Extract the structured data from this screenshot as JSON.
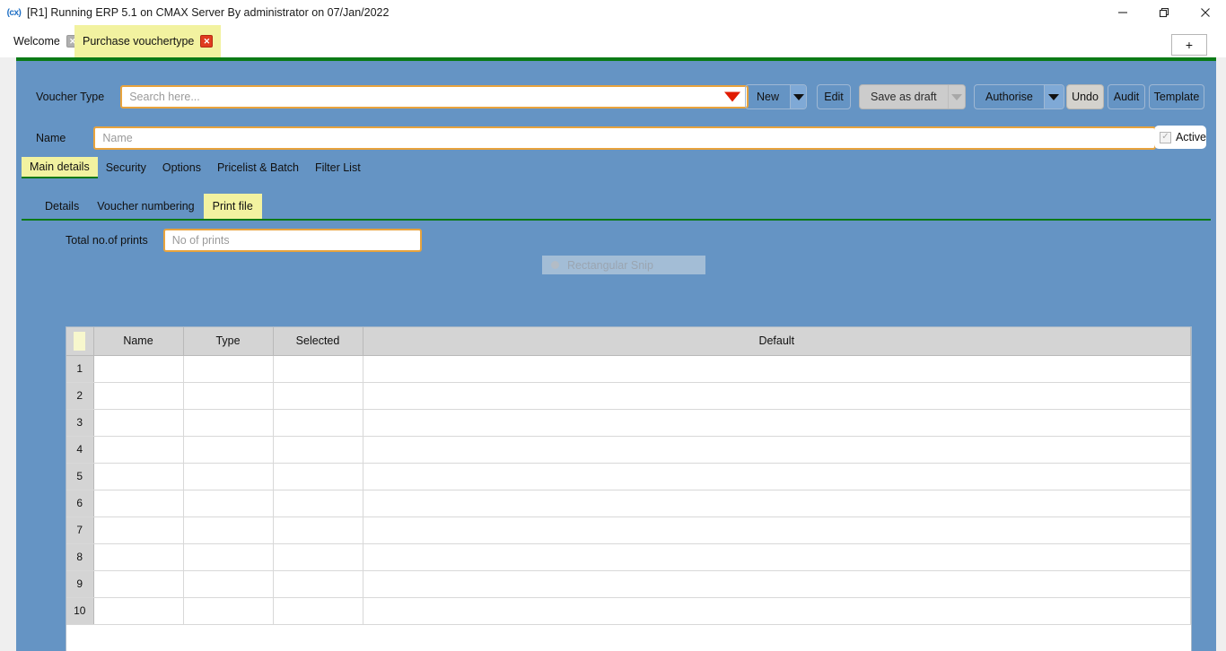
{
  "window": {
    "app_icon": "cmax-icon",
    "title": "[R1] Running ERP 5.1 on CMAX Server By administrator on 07/Jan/2022",
    "controls": {
      "minimize": "minimize-icon",
      "restore": "restore-icon",
      "close": "close-icon"
    }
  },
  "tabbar": {
    "tabs": [
      {
        "label": "Welcome",
        "active": false,
        "close_icon": "close-icon"
      },
      {
        "label": "Purchase vouchertype",
        "active": true,
        "close_icon": "close-icon"
      }
    ],
    "new_tab_label": "+"
  },
  "toolbar": {
    "voucher_type_label": "Voucher Type",
    "search_placeholder": "Search here...",
    "search_value": "",
    "dropdown_icon": "caret-down-icon",
    "buttons": [
      {
        "label": "New",
        "type": "split",
        "enabled": true
      },
      {
        "label": "Edit",
        "type": "plain",
        "enabled": true
      },
      {
        "label": "Save as draft",
        "type": "split",
        "enabled": false
      },
      {
        "label": "Authorise",
        "type": "split",
        "enabled": true
      },
      {
        "label": "Undo",
        "type": "plain",
        "enabled": false
      },
      {
        "label": "Audit",
        "type": "plain",
        "enabled": true
      },
      {
        "label": "Template",
        "type": "plain",
        "enabled": true
      }
    ]
  },
  "name_row": {
    "label": "Name",
    "placeholder": "Name",
    "value": "",
    "active_checkbox": {
      "label": "Active",
      "checked": true,
      "enabled": false,
      "check_icon": "check-icon"
    }
  },
  "main_tabs": [
    {
      "label": "Main details",
      "active": true
    },
    {
      "label": "Security",
      "active": false
    },
    {
      "label": "Options",
      "active": false
    },
    {
      "label": "Pricelist & Batch",
      "active": false
    },
    {
      "label": "Filter List",
      "active": false
    }
  ],
  "sub_tabs": [
    {
      "label": "Details",
      "active": false
    },
    {
      "label": "Voucher numbering",
      "active": false
    },
    {
      "label": "Print file",
      "active": true
    }
  ],
  "print_file": {
    "total_prints_label": "Total no.of prints",
    "total_prints_placeholder": "No of prints",
    "total_prints_value": "",
    "grid": {
      "columns": [
        "",
        "Name",
        "Type",
        "Selected",
        "Default"
      ],
      "rows": [
        {
          "no": "1",
          "name": "",
          "type": "",
          "selected": "",
          "default": ""
        },
        {
          "no": "2",
          "name": "",
          "type": "",
          "selected": "",
          "default": ""
        },
        {
          "no": "3",
          "name": "",
          "type": "",
          "selected": "",
          "default": ""
        },
        {
          "no": "4",
          "name": "",
          "type": "",
          "selected": "",
          "default": ""
        },
        {
          "no": "5",
          "name": "",
          "type": "",
          "selected": "",
          "default": ""
        },
        {
          "no": "6",
          "name": "",
          "type": "",
          "selected": "",
          "default": ""
        },
        {
          "no": "7",
          "name": "",
          "type": "",
          "selected": "",
          "default": ""
        },
        {
          "no": "8",
          "name": "",
          "type": "",
          "selected": "",
          "default": ""
        },
        {
          "no": "9",
          "name": "",
          "type": "",
          "selected": "",
          "default": ""
        },
        {
          "no": "10",
          "name": "",
          "type": "",
          "selected": "",
          "default": ""
        }
      ]
    }
  },
  "overlay": {
    "snip_label": "Rectangular Snip"
  },
  "colors": {
    "work_area_blue": "#6594c4",
    "accent_green": "#0b7a16",
    "active_tab_yellow": "#f2f2a0",
    "field_border_orange": "#e8a33d",
    "caret_red": "#e11b00",
    "header_gray": "#d4d4d4"
  }
}
